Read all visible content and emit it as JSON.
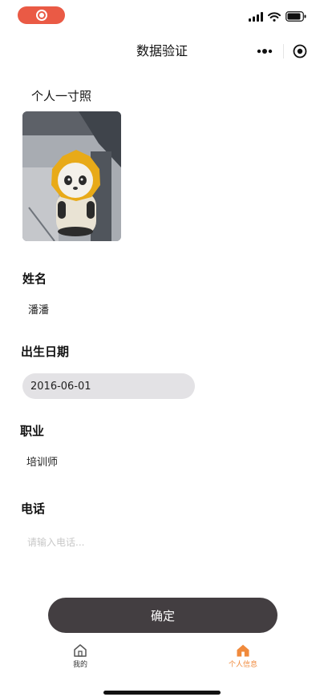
{
  "colors": {
    "accent": "#f08a3c",
    "record": "#ea5a45",
    "button": "#433e41",
    "date_pill": "#e3e2e5",
    "placeholder": "#c8c8c8"
  },
  "statusbar": {
    "icons": [
      "record-icon",
      "signal-icon",
      "wifi-icon",
      "battery-icon"
    ]
  },
  "nav": {
    "title": "数据验证",
    "icons": [
      "more-icon",
      "close-circle-icon"
    ]
  },
  "form": {
    "photo_label": "个人一寸照",
    "name_label": "姓名",
    "name_value": "潘潘",
    "birth_label": "出生日期",
    "birth_value": "2016-06-01",
    "job_label": "职业",
    "job_value": "培训师",
    "phone_label": "电话",
    "phone_value": "",
    "phone_placeholder": "请输入电话..."
  },
  "confirm_label": "确定",
  "tabbar": {
    "tabs": [
      {
        "label": "我的",
        "icon": "home-outline-icon",
        "active": false
      },
      {
        "label": "个人信息",
        "icon": "home-filled-icon",
        "active": true
      }
    ]
  }
}
